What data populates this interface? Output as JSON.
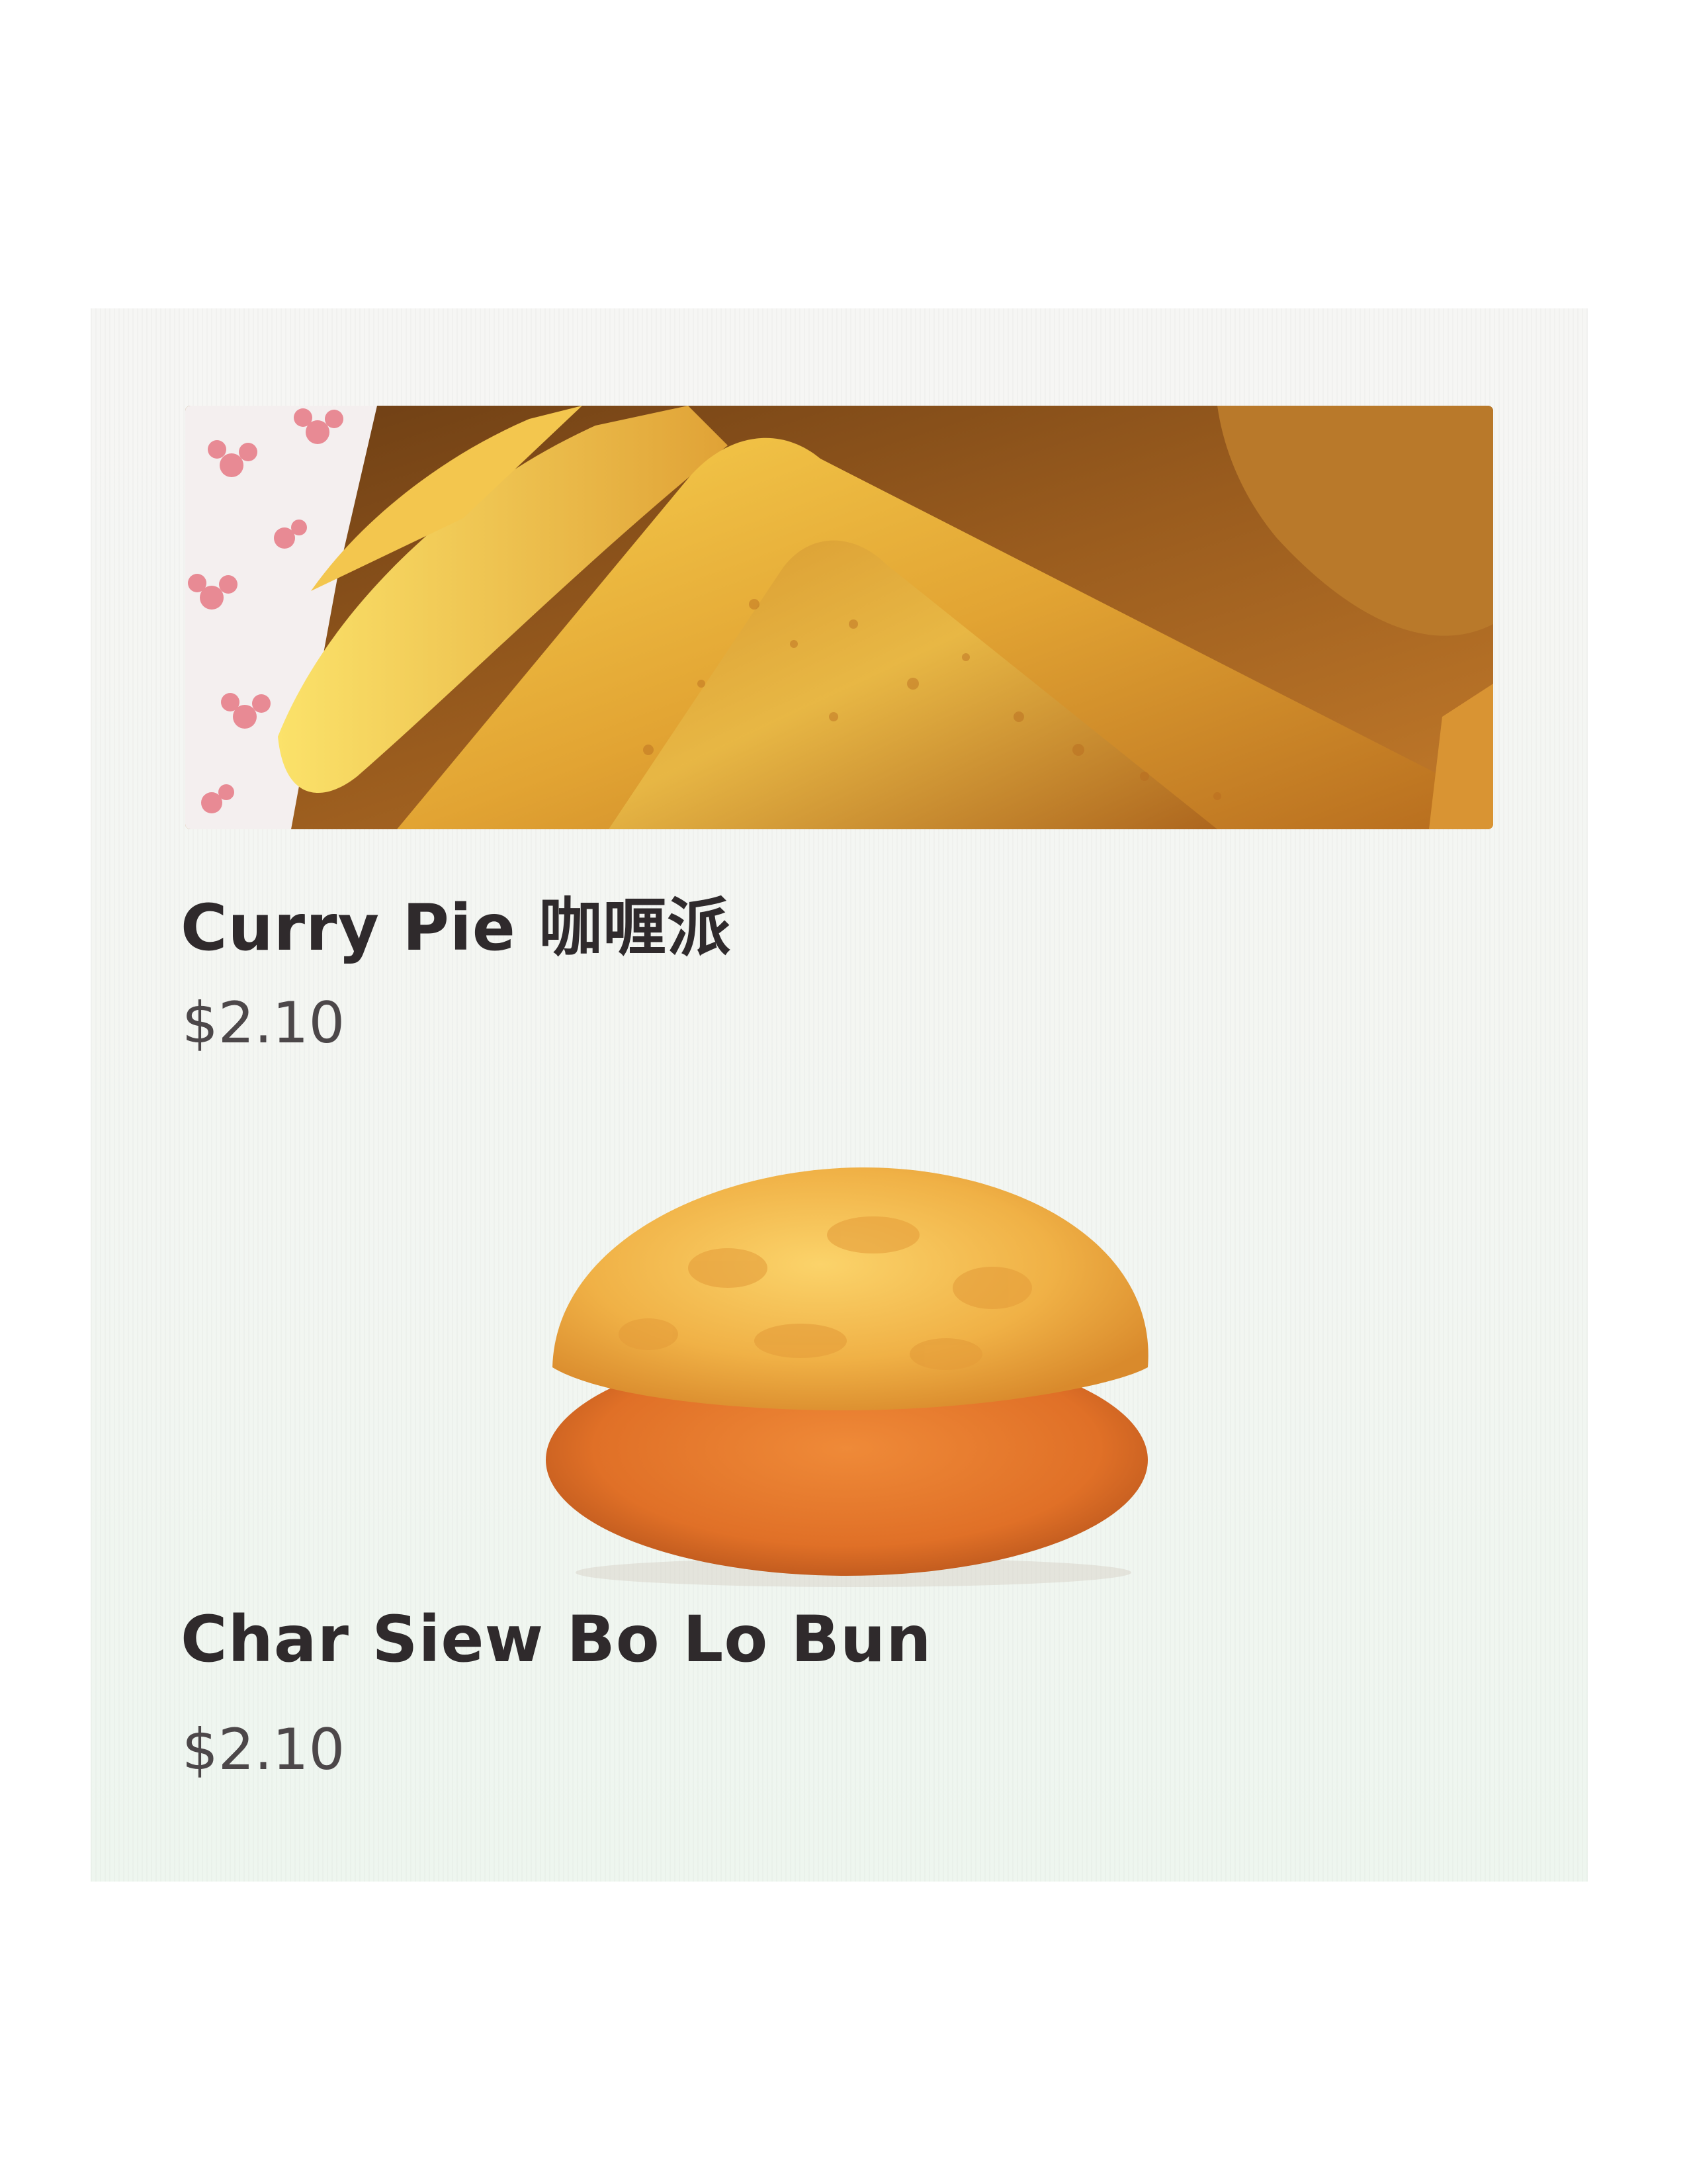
{
  "menu": {
    "items": [
      {
        "name": "Curry Pie 咖喱派",
        "price": "$2.10",
        "image": "curry-pie-photo"
      },
      {
        "name": "Char Siew Bo Lo Bun",
        "price": "$2.10",
        "image": "bo-lo-bun-photo"
      }
    ]
  },
  "colors": {
    "text_primary": "#2f2a2c",
    "text_secondary": "#4c4749",
    "screen_background": "#f5f6f3"
  }
}
